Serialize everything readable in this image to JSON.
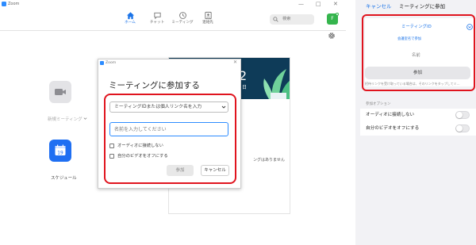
{
  "app": {
    "window_title": "Zoom",
    "window_controls": [
      "—",
      "□",
      "✕"
    ]
  },
  "nav": {
    "items": [
      {
        "label": "ホーム",
        "icon": "home-icon",
        "active": true
      },
      {
        "label": "チャット",
        "icon": "chat-icon",
        "active": false
      },
      {
        "label": "ミーティング",
        "icon": "clock-icon",
        "active": false
      },
      {
        "label": "連絡先",
        "icon": "contacts-icon",
        "active": false
      }
    ],
    "search_placeholder": "検索",
    "avatar_initial": "F"
  },
  "home": {
    "new_meeting_label": "新規ミーティング",
    "schedule_label": "スケジュール",
    "schedule_icon_day": "19",
    "calendar_time": "2",
    "calendar_day": "日",
    "calendar_empty": "ングはありません"
  },
  "dialog": {
    "title": "Zoom",
    "heading": "ミーティングに参加する",
    "id_placeholder": "ミーティングIDまたは個人リンク名を入力",
    "name_placeholder": "名前を入力してください",
    "checkbox_audio": "オーディオに接続しない",
    "checkbox_video": "自分のビデオをオフにする",
    "join_button": "参加",
    "cancel_button": "キャンセル"
  },
  "mobile": {
    "cancel": "キャンセル",
    "title": "ミーティングに参加",
    "id_field": "ミーティングID",
    "personal_link": "会議室名で参加",
    "name_field": "名前",
    "join_button": "参加",
    "note": "招待リンクを受け取っている場合は、そのリンクをタップしてミ...",
    "options_header": "参加オプション",
    "option_audio": "オーディオに接続しない",
    "option_video": "自分のビデオをオフにする"
  },
  "colors": {
    "accent": "#1a73e8",
    "highlight": "#e0141e",
    "calendar_header": "#0e3b58",
    "schedule_tile": "#1f6ff2"
  }
}
